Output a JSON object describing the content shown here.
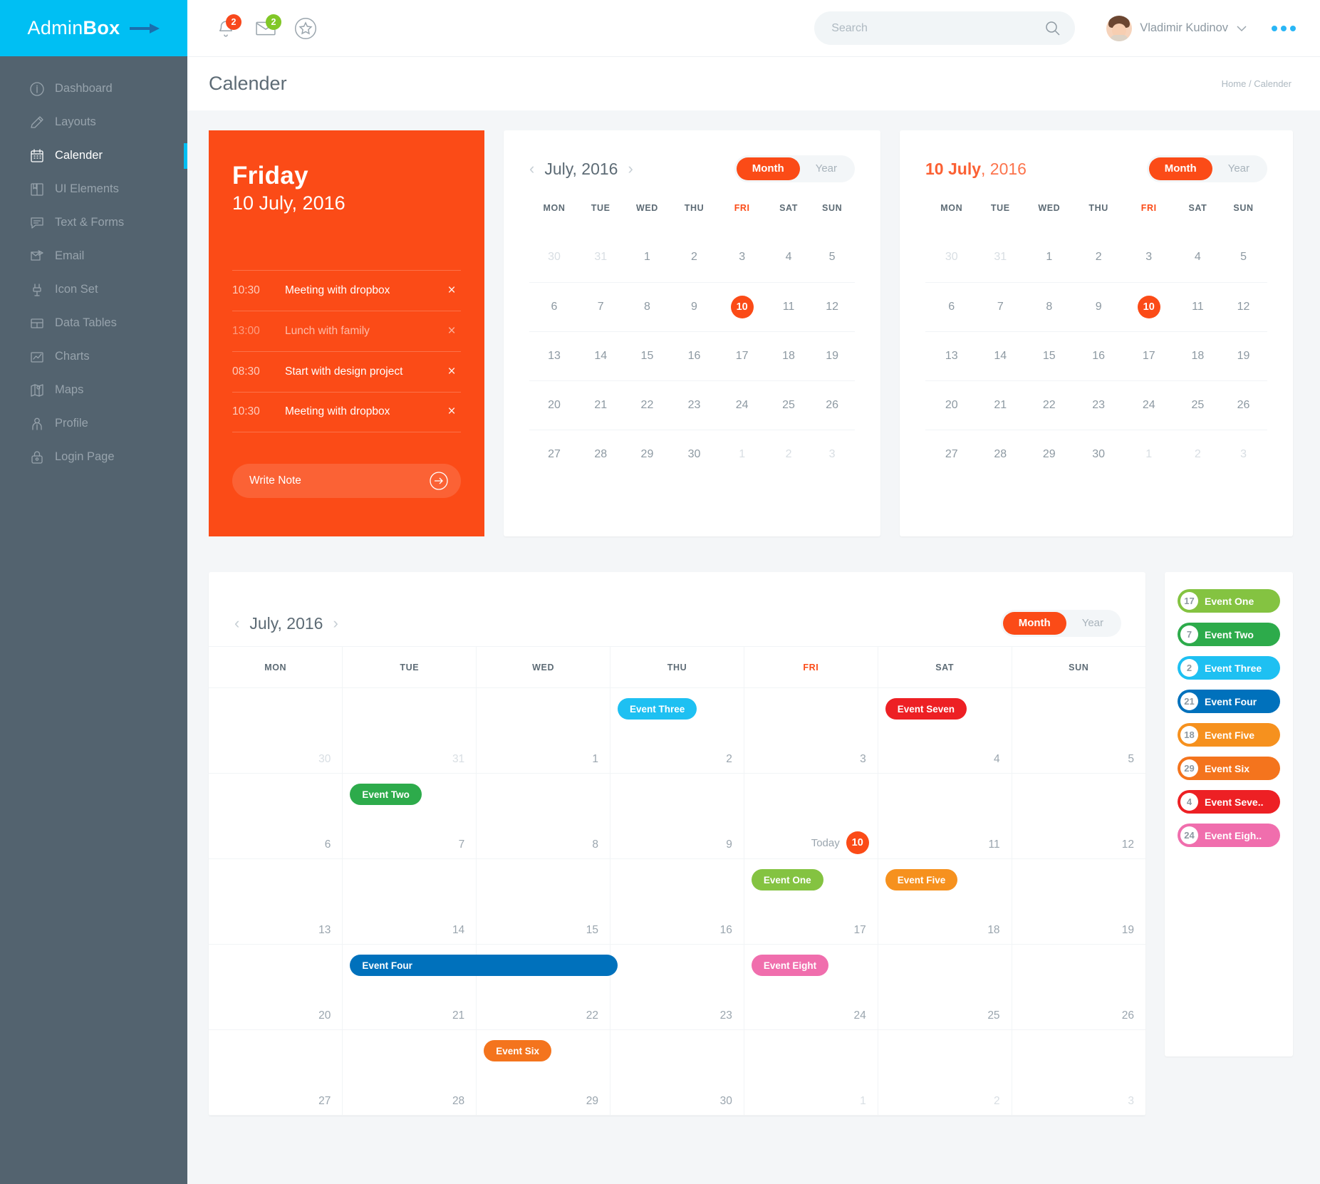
{
  "brand": {
    "first": "Admin",
    "second": "Box"
  },
  "sidebar": {
    "items": [
      {
        "label": "Dashboard",
        "icon": "info-icon",
        "active": false
      },
      {
        "label": "Layouts",
        "icon": "pencil-icon",
        "active": false
      },
      {
        "label": "Calender",
        "icon": "calendar-icon",
        "active": true
      },
      {
        "label": "UI Elements",
        "icon": "book-icon",
        "active": false
      },
      {
        "label": "Text & Forms",
        "icon": "chat-icon",
        "active": false
      },
      {
        "label": "Email",
        "icon": "envelope-icon",
        "active": false
      },
      {
        "label": "Icon Set",
        "icon": "plug-icon",
        "active": false
      },
      {
        "label": "Data Tables",
        "icon": "table-icon",
        "active": false
      },
      {
        "label": "Charts",
        "icon": "chart-icon",
        "active": false
      },
      {
        "label": "Maps",
        "icon": "map-icon",
        "active": false
      },
      {
        "label": "Profile",
        "icon": "user-icon",
        "active": false
      },
      {
        "label": "Login Page",
        "icon": "lock-icon",
        "active": false
      }
    ]
  },
  "topbar": {
    "notifications": {
      "icon": "bell-icon",
      "count": "2",
      "color": "#f8481c"
    },
    "messages": {
      "icon": "envelope-icon",
      "count": "2",
      "color": "#81c727"
    },
    "favorites": {
      "icon": "star-icon"
    },
    "search": {
      "placeholder": "Search",
      "value": "",
      "icon": "search-icon"
    },
    "user": {
      "name": "Vladimir Kudinov",
      "chevron": "chevron-down-icon"
    },
    "more": "more-dots-icon"
  },
  "page": {
    "title": "Calender",
    "breadcrumb": {
      "home": "Home",
      "separator": "/",
      "current": "Calender"
    }
  },
  "day_panel": {
    "day_name": "Friday",
    "date": "10 July, 2016",
    "events": [
      {
        "time": "10:30",
        "name": "Meeting with dropbox",
        "dim": false
      },
      {
        "time": "13:00",
        "name": "Lunch with family",
        "dim": true
      },
      {
        "time": "08:30",
        "name": "Start with design project",
        "dim": false
      },
      {
        "time": "10:30",
        "name": "Meeting with dropbox",
        "dim": false
      }
    ],
    "write_note": "Write Note",
    "close_glyph": "×",
    "arrow_icon": "arrow-right-circle-icon"
  },
  "toggle": {
    "month": "Month",
    "year": "Year",
    "selected": "Month"
  },
  "weekdays": [
    "MON",
    "TUE",
    "WED",
    "THU",
    "FRI",
    "SAT",
    "SUN"
  ],
  "mini_calendar_left": {
    "title": "July, 2016",
    "prev_icon": "chevron-left-icon",
    "next_icon": "chevron-right-icon",
    "weeks": [
      [
        {
          "d": "30",
          "m": true
        },
        {
          "d": "31",
          "m": true
        },
        {
          "d": "1"
        },
        {
          "d": "2"
        },
        {
          "d": "3"
        },
        {
          "d": "4"
        },
        {
          "d": "5"
        }
      ],
      [
        {
          "d": "6"
        },
        {
          "d": "7"
        },
        {
          "d": "8"
        },
        {
          "d": "9"
        },
        {
          "d": "10",
          "today": true
        },
        {
          "d": "11"
        },
        {
          "d": "12"
        }
      ],
      [
        {
          "d": "13"
        },
        {
          "d": "14"
        },
        {
          "d": "15"
        },
        {
          "d": "16"
        },
        {
          "d": "17"
        },
        {
          "d": "18"
        },
        {
          "d": "19"
        }
      ],
      [
        {
          "d": "20"
        },
        {
          "d": "21"
        },
        {
          "d": "22"
        },
        {
          "d": "23"
        },
        {
          "d": "24"
        },
        {
          "d": "25"
        },
        {
          "d": "26"
        }
      ],
      [
        {
          "d": "27"
        },
        {
          "d": "28"
        },
        {
          "d": "29"
        },
        {
          "d": "30"
        },
        {
          "d": "1",
          "m": true
        },
        {
          "d": "2",
          "m": true
        },
        {
          "d": "3",
          "m": true
        }
      ]
    ]
  },
  "mini_calendar_right": {
    "title_bold": "10 July",
    "title_rest": ", 2016",
    "weeks": [
      [
        {
          "d": "30",
          "m": true
        },
        {
          "d": "31",
          "m": true
        },
        {
          "d": "1"
        },
        {
          "d": "2"
        },
        {
          "d": "3"
        },
        {
          "d": "4"
        },
        {
          "d": "5"
        }
      ],
      [
        {
          "d": "6"
        },
        {
          "d": "7"
        },
        {
          "d": "8"
        },
        {
          "d": "9"
        },
        {
          "d": "10",
          "today": true
        },
        {
          "d": "11"
        },
        {
          "d": "12"
        }
      ],
      [
        {
          "d": "13"
        },
        {
          "d": "14"
        },
        {
          "d": "15"
        },
        {
          "d": "16"
        },
        {
          "d": "17"
        },
        {
          "d": "18"
        },
        {
          "d": "19"
        }
      ],
      [
        {
          "d": "20"
        },
        {
          "d": "21"
        },
        {
          "d": "22"
        },
        {
          "d": "23"
        },
        {
          "d": "24"
        },
        {
          "d": "25"
        },
        {
          "d": "26"
        }
      ],
      [
        {
          "d": "27"
        },
        {
          "d": "28"
        },
        {
          "d": "29"
        },
        {
          "d": "30"
        },
        {
          "d": "1",
          "m": true
        },
        {
          "d": "2",
          "m": true
        },
        {
          "d": "3",
          "m": true
        }
      ]
    ]
  },
  "big_calendar": {
    "title": "July, 2016",
    "prev_icon": "chevron-left-icon",
    "next_icon": "chevron-right-icon",
    "today_label": "Today",
    "weeks": [
      [
        {
          "d": "30",
          "m": true
        },
        {
          "d": "31",
          "m": true
        },
        {
          "d": "1"
        },
        {
          "d": "2",
          "event": {
            "label": "Event Three",
            "color": "#1ec0f2",
            "span": 1
          }
        },
        {
          "d": "3"
        },
        {
          "d": "4",
          "event": {
            "label": "Event Seven",
            "color": "#ed2024",
            "span": 1
          }
        },
        {
          "d": "5"
        }
      ],
      [
        {
          "d": "6"
        },
        {
          "d": "7",
          "event": {
            "label": "Event Two",
            "color": "#2dab4b",
            "span": 1
          }
        },
        {
          "d": "8"
        },
        {
          "d": "9"
        },
        {
          "d": "10",
          "today": true
        },
        {
          "d": "11"
        },
        {
          "d": "12"
        }
      ],
      [
        {
          "d": "13"
        },
        {
          "d": "14"
        },
        {
          "d": "15"
        },
        {
          "d": "16"
        },
        {
          "d": "17",
          "event": {
            "label": "Event One",
            "color": "#84c341",
            "span": 1
          }
        },
        {
          "d": "18",
          "event": {
            "label": "Event Five",
            "color": "#f6911e",
            "span": 1
          }
        },
        {
          "d": "19"
        }
      ],
      [
        {
          "d": "20"
        },
        {
          "d": "21",
          "event": {
            "label": "Event Four",
            "color": "#0071bc",
            "span": 2
          }
        },
        {
          "d": "22"
        },
        {
          "d": "23"
        },
        {
          "d": "24",
          "event": {
            "label": "Event Eight",
            "color": "#f06ead",
            "span": 1
          }
        },
        {
          "d": "25"
        },
        {
          "d": "26"
        }
      ],
      [
        {
          "d": "27"
        },
        {
          "d": "28"
        },
        {
          "d": "29",
          "event": {
            "label": "Event Six",
            "color": "#f4741d",
            "span": 1
          }
        },
        {
          "d": "30"
        },
        {
          "d": "1",
          "m": true
        },
        {
          "d": "2",
          "m": true
        },
        {
          "d": "3",
          "m": true
        }
      ]
    ]
  },
  "legend": {
    "items": [
      {
        "num": "17",
        "label": "Event One",
        "color": "#84c341"
      },
      {
        "num": "7",
        "label": "Event Two",
        "color": "#2dab4b"
      },
      {
        "num": "2",
        "label": "Event Three",
        "color": "#1ec0f2"
      },
      {
        "num": "21",
        "label": "Event Four",
        "color": "#0071bc"
      },
      {
        "num": "18",
        "label": "Event Five",
        "color": "#f6911e"
      },
      {
        "num": "29",
        "label": "Event Six",
        "color": "#f4741d"
      },
      {
        "num": "4",
        "label": "Event Seve..",
        "color": "#ed2024"
      },
      {
        "num": "24",
        "label": "Event Eigh..",
        "color": "#f06ead"
      }
    ]
  },
  "colors": {
    "accent_orange": "#fb4b17",
    "brand_cyan": "#00bff3",
    "sidebar": "#53636f"
  }
}
